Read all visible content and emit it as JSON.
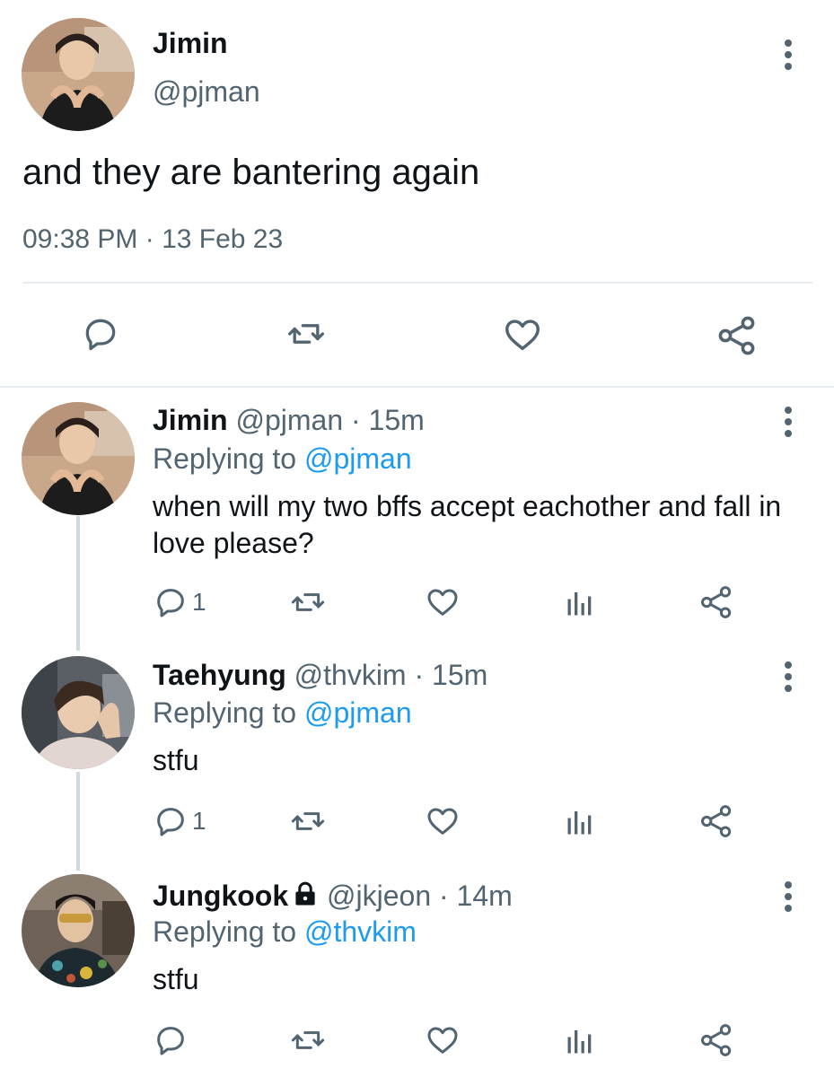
{
  "main_tweet": {
    "name": "Jimin",
    "handle": "@pjman",
    "text": "and they are bantering again",
    "timestamp": "09:38 PM · 13 Feb 23",
    "actions": [
      "reply-icon",
      "retweet-icon",
      "like-icon",
      "share-icon"
    ]
  },
  "replies": [
    {
      "name": "Jimin",
      "handle": "@pjman",
      "time": "· 15m",
      "replying_label": "Replying to",
      "replying_to": "@pjman",
      "text": "when will my two bffs accept eachother and fall in love please?",
      "reply_count": "1"
    },
    {
      "name": "Taehyung",
      "handle": "@thvkim",
      "time": "· 15m",
      "replying_label": "Replying to",
      "replying_to": "@pjman",
      "text": "stfu",
      "reply_count": "1"
    },
    {
      "name": "Jungkook",
      "handle": "@jkjeon",
      "time": "· 14m",
      "protected": true,
      "replying_label": "Replying to",
      "replying_to": "@thvkim",
      "text": "stfu",
      "reply_count": ""
    }
  ],
  "colors": {
    "text": "#0f1419",
    "secondary": "#536471",
    "accent": "#1d9bf0",
    "divider": "#e6ecf0",
    "thread": "#cfd9de"
  }
}
